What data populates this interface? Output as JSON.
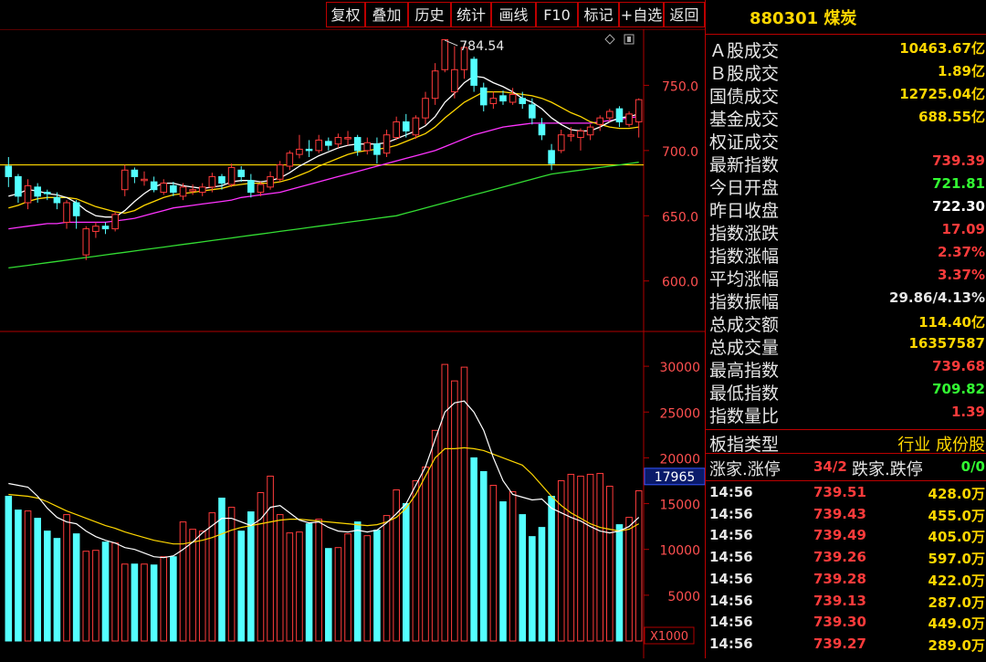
{
  "toolbar": {
    "buttons": [
      "复权",
      "叠加",
      "历史",
      "统计",
      "画线",
      "F10",
      "标记",
      "+自选",
      "返回"
    ]
  },
  "colors": {
    "up": "#ff3b3b",
    "down": "#54ffff",
    "ma_white": "#ffffff",
    "ma_yellow": "#ffd700",
    "ma_magenta": "#ff33ff",
    "ma_green": "#33dd33",
    "border": "#b00000"
  },
  "panel": {
    "title": "880301 煤炭",
    "stats": [
      {
        "label": "Ａ股成交",
        "value": "10463.67亿",
        "color": "#ffd700"
      },
      {
        "label": "Ｂ股成交",
        "value": "1.89亿",
        "color": "#ffd700"
      },
      {
        "label": "国债成交",
        "value": "12725.04亿",
        "color": "#ffd700"
      },
      {
        "label": "基金成交",
        "value": "688.55亿",
        "color": "#ffd700"
      },
      {
        "label": "权证成交",
        "value": "",
        "color": "#ffd700"
      },
      {
        "label": "最新指数",
        "value": "739.39",
        "color": "#ff3b3b"
      },
      {
        "label": "今日开盘",
        "value": "721.81",
        "color": "#33ff33"
      },
      {
        "label": "昨日收盘",
        "value": "722.30",
        "color": "#ffffff"
      },
      {
        "label": "指数涨跌",
        "value": "17.09",
        "color": "#ff3b3b"
      },
      {
        "label": "指数涨幅",
        "value": "2.37%",
        "color": "#ff3b3b"
      },
      {
        "label": "平均涨幅",
        "value": "3.37%",
        "color": "#ff3b3b"
      },
      {
        "label": "指数振幅",
        "value": "29.86/4.13%",
        "color": "#e6e6e6"
      },
      {
        "label": "总成交额",
        "value": "114.40亿",
        "color": "#ffd700"
      },
      {
        "label": "总成交量",
        "value": "16357587",
        "color": "#ffd700"
      },
      {
        "label": "最高指数",
        "value": "739.68",
        "color": "#ff3b3b"
      },
      {
        "label": "最低指数",
        "value": "709.82",
        "color": "#33ff33"
      },
      {
        "label": "指数量比",
        "value": "1.39",
        "color": "#ff3b3b"
      }
    ],
    "type_label": "板指类型",
    "type_value": "行业 成份股",
    "zd_label1": "涨家.涨停",
    "zd_value1": "34/2",
    "zd_label2": "跌家.跌停",
    "zd_value2": "0/0",
    "ticks": [
      {
        "time": "14:56",
        "price": "739.51",
        "vol": "428.0万"
      },
      {
        "time": "14:56",
        "price": "739.43",
        "vol": "455.0万"
      },
      {
        "time": "14:56",
        "price": "739.49",
        "vol": "405.0万"
      },
      {
        "time": "14:56",
        "price": "739.26",
        "vol": "597.0万"
      },
      {
        "time": "14:56",
        "price": "739.28",
        "vol": "422.0万"
      },
      {
        "time": "14:56",
        "price": "739.13",
        "vol": "287.0万"
      },
      {
        "time": "14:56",
        "price": "739.30",
        "vol": "449.0万"
      },
      {
        "time": "14:56",
        "price": "739.27",
        "vol": "289.0万"
      }
    ]
  },
  "chart_data": [
    {
      "type": "candlestick",
      "yticks": [
        600,
        650,
        700,
        750
      ],
      "ylim": [
        562,
        793
      ],
      "high_annotation": "784.54",
      "high_value": 784.54,
      "reference_line": 689,
      "candles": [
        [
          688,
          680,
          695,
          672
        ],
        [
          680,
          665,
          682,
          660
        ],
        [
          660,
          673,
          678,
          655
        ],
        [
          672,
          665,
          675,
          660
        ],
        [
          668,
          667,
          670,
          662
        ],
        [
          664,
          660,
          668,
          655
        ],
        [
          645,
          660,
          662,
          640
        ],
        [
          660,
          650,
          662,
          640
        ],
        [
          620,
          640,
          642,
          616
        ],
        [
          638,
          642,
          645,
          633
        ],
        [
          642,
          640,
          645,
          636
        ],
        [
          640,
          651,
          653,
          638
        ],
        [
          670,
          685,
          689,
          665
        ],
        [
          685,
          680,
          687,
          675
        ],
        [
          678,
          678,
          684,
          673
        ],
        [
          676,
          670,
          680,
          668
        ],
        [
          668,
          675,
          678,
          666
        ],
        [
          673,
          668,
          676,
          665
        ],
        [
          665,
          672,
          675,
          662
        ],
        [
          670,
          670,
          674,
          666
        ],
        [
          668,
          672,
          675,
          665
        ],
        [
          672,
          680,
          683,
          668
        ],
        [
          680,
          675,
          682,
          670
        ],
        [
          674,
          687,
          690,
          672
        ],
        [
          685,
          680,
          688,
          676
        ],
        [
          677,
          668,
          682,
          664
        ],
        [
          668,
          674,
          676,
          665
        ],
        [
          672,
          680,
          684,
          670
        ],
        [
          678,
          689,
          692,
          676
        ],
        [
          688,
          698,
          700,
          685
        ],
        [
          697,
          701,
          712,
          694
        ],
        [
          701,
          700,
          708,
          695
        ],
        [
          700,
          708,
          712,
          698
        ],
        [
          707,
          704,
          710,
          700
        ],
        [
          705,
          710,
          713,
          702
        ],
        [
          710,
          710,
          715,
          704
        ],
        [
          710,
          700,
          712,
          696
        ],
        [
          700,
          706,
          710,
          697
        ],
        [
          705,
          697,
          710,
          690
        ],
        [
          698,
          712,
          716,
          695
        ],
        [
          710,
          722,
          726,
          708
        ],
        [
          722,
          715,
          728,
          710
        ],
        [
          712,
          725,
          727,
          709
        ],
        [
          725,
          740,
          745,
          720
        ],
        [
          740,
          761,
          767,
          735
        ],
        [
          762,
          785,
          785,
          760
        ],
        [
          745,
          762,
          780,
          740
        ],
        [
          762,
          779,
          782,
          755
        ],
        [
          770,
          750,
          772,
          745
        ],
        [
          748,
          735,
          752,
          730
        ],
        [
          736,
          740,
          745,
          732
        ],
        [
          742,
          738,
          746,
          735
        ],
        [
          737,
          743,
          748,
          735
        ],
        [
          740,
          736,
          745,
          732
        ],
        [
          735,
          725,
          740,
          720
        ],
        [
          720,
          712,
          725,
          708
        ],
        [
          700,
          690,
          705,
          685
        ],
        [
          700,
          712,
          716,
          698
        ],
        [
          712,
          712,
          718,
          707
        ],
        [
          710,
          715,
          717,
          700
        ],
        [
          712,
          718,
          720,
          708
        ],
        [
          720,
          725,
          727,
          715
        ],
        [
          725,
          730,
          732,
          722
        ],
        [
          732,
          722,
          734,
          718
        ],
        [
          720,
          728,
          730,
          718
        ],
        [
          722,
          739,
          740,
          710
        ]
      ],
      "ma": {
        "white": [
          665,
          667,
          670,
          669,
          667,
          666,
          664,
          660,
          654,
          650,
          649,
          649,
          654,
          661,
          667,
          672,
          675,
          675,
          673,
          672,
          671,
          672,
          673,
          676,
          677,
          677,
          676,
          677,
          679,
          683,
          688,
          692,
          696,
          699,
          702,
          704,
          705,
          705,
          705,
          706,
          709,
          712,
          715,
          719,
          726,
          737,
          744,
          752,
          757,
          756,
          752,
          749,
          745,
          740,
          737,
          732,
          725,
          720,
          716,
          715,
          715,
          718,
          722,
          725,
          726,
          728
        ],
        "yellow": [
          656,
          658,
          661,
          663,
          664,
          664,
          664,
          663,
          660,
          657,
          655,
          653,
          652,
          654,
          658,
          661,
          664,
          666,
          667,
          668,
          669,
          670,
          671,
          673,
          674,
          675,
          675,
          675,
          676,
          678,
          681,
          684,
          688,
          691,
          694,
          697,
          699,
          700,
          701,
          702,
          704,
          707,
          710,
          713,
          718,
          725,
          731,
          737,
          741,
          745,
          745,
          745,
          744,
          743,
          742,
          740,
          737,
          733,
          729,
          726,
          722,
          720,
          718,
          717,
          717,
          718
        ],
        "magenta": [
          640,
          641,
          642,
          643,
          644,
          644,
          645,
          645,
          645,
          645,
          645,
          646,
          647,
          648,
          650,
          652,
          654,
          656,
          657,
          658,
          659,
          660,
          661,
          662,
          664,
          665,
          666,
          667,
          668,
          670,
          672,
          674,
          676,
          678,
          680,
          682,
          684,
          686,
          688,
          690,
          692,
          694,
          696,
          698,
          700,
          703,
          706,
          709,
          712,
          714,
          716,
          718,
          719,
          720,
          721,
          721,
          721,
          721,
          721,
          721,
          721,
          722,
          723,
          724,
          725,
          726
        ],
        "green": [
          610,
          611,
          612,
          613,
          614,
          615,
          616,
          617,
          618,
          619,
          620,
          621,
          622,
          623,
          624,
          625,
          626,
          627,
          628,
          629,
          630,
          631,
          632,
          633,
          634,
          635,
          636,
          637,
          638,
          639,
          640,
          641,
          642,
          643,
          644,
          645,
          646,
          647,
          648,
          649,
          650,
          652,
          654,
          656,
          658,
          660,
          662,
          664,
          666,
          668,
          670,
          672,
          674,
          676,
          678,
          680,
          682,
          683,
          684,
          685,
          686,
          687,
          688,
          689,
          690,
          691
        ]
      }
    },
    {
      "type": "bar",
      "yticks": [
        5000,
        10000,
        15000,
        20000,
        25000,
        30000
      ],
      "ylim": [
        0,
        33500
      ],
      "unit_label": "X1000",
      "current_label": "17965",
      "volumes": [
        15800,
        14300,
        14200,
        13400,
        12000,
        11200,
        13800,
        11700,
        9800,
        9900,
        10800,
        10700,
        8400,
        8400,
        8400,
        8300,
        9200,
        9200,
        13000,
        12200,
        12000,
        14000,
        15600,
        14600,
        12000,
        14100,
        16200,
        18000,
        13800,
        11800,
        11900,
        12800,
        13300,
        10100,
        10200,
        11700,
        13000,
        11500,
        12100,
        13700,
        16500,
        15000,
        17500,
        19000,
        23000,
        30200,
        28400,
        29900,
        20000,
        18500,
        17000,
        15200,
        16300,
        13800,
        11400,
        12400,
        15800,
        17500,
        18200,
        18000,
        18200,
        18300,
        16900,
        12700,
        13500,
        16400
      ],
      "ma": {
        "white": [
          17200,
          17000,
          16800,
          15800,
          14500,
          13500,
          13000,
          12800,
          12000,
          11400,
          11000,
          10700,
          10200,
          10000,
          9600,
          9200,
          9100,
          9300,
          10000,
          10800,
          11800,
          12600,
          13400,
          13400,
          13000,
          12600,
          13300,
          14600,
          14800,
          14000,
          13200,
          12900,
          13000,
          12400,
          12000,
          11900,
          12100,
          11900,
          12100,
          12900,
          13900,
          15000,
          17000,
          19000,
          22000,
          25000,
          26000,
          26200,
          25000,
          23000,
          20000,
          17500,
          16000,
          15700,
          15400,
          15500,
          14500,
          14000,
          13500,
          13100,
          12500,
          12000,
          11800,
          12000,
          12500,
          13500
        ],
        "yellow": [
          16000,
          15900,
          15800,
          15600,
          15200,
          14700,
          14200,
          13800,
          13400,
          13000,
          12600,
          12300,
          11900,
          11600,
          11300,
          11000,
          10800,
          10600,
          10600,
          10800,
          11000,
          11300,
          11700,
          12100,
          12400,
          12600,
          12800,
          13000,
          13200,
          13300,
          13300,
          13200,
          13100,
          13000,
          12900,
          12800,
          12700,
          12600,
          12700,
          13000,
          13500,
          14500,
          16000,
          18000,
          20000,
          21000,
          21000,
          21100,
          21000,
          20800,
          20400,
          20000,
          19600,
          19200,
          18200,
          17000,
          15800,
          14800,
          14000,
          13400,
          12800,
          12400,
          12200,
          12000,
          12200,
          12800
        ]
      }
    }
  ]
}
